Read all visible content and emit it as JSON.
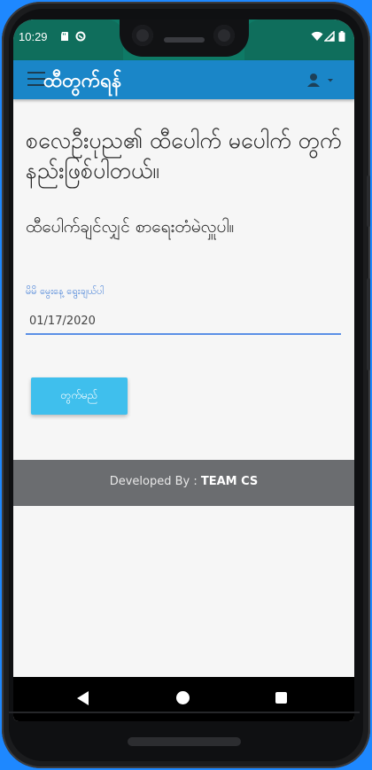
{
  "status_bar": {
    "time": "10:29",
    "icons": [
      "sd-card-icon",
      "data-saver-icon",
      "wifi-icon",
      "signal-icon",
      "battery-icon"
    ]
  },
  "app_bar": {
    "title": "ထီတွက်ရန်",
    "menu_icon": "hamburger-menu-icon",
    "user_icon": "user-icon"
  },
  "main": {
    "heading": "စလေဦးပုည၏ ထီပေါက် မပေါက် တွက်နည်းဖြစ်ပါတယ်။",
    "subheading": "ထီပေါက်ချင်လျှင် စာရေးတံမဲလှူပါ။",
    "date_field": {
      "label": "မိမိ မွေးနေ့ ရွေးချယ်ပါ",
      "value": "01/17/2020"
    },
    "submit_label": "တွက်မည်"
  },
  "footer": {
    "prefix": "Developed By : ",
    "team": "TEAM CS"
  },
  "colors": {
    "page_background": "#1e88ff",
    "status_bar": "#0e7a66",
    "app_bar": "#1a86c8",
    "button": "#3fbfed",
    "footer": "#6b6d70",
    "input_underline": "#5b90e6"
  }
}
